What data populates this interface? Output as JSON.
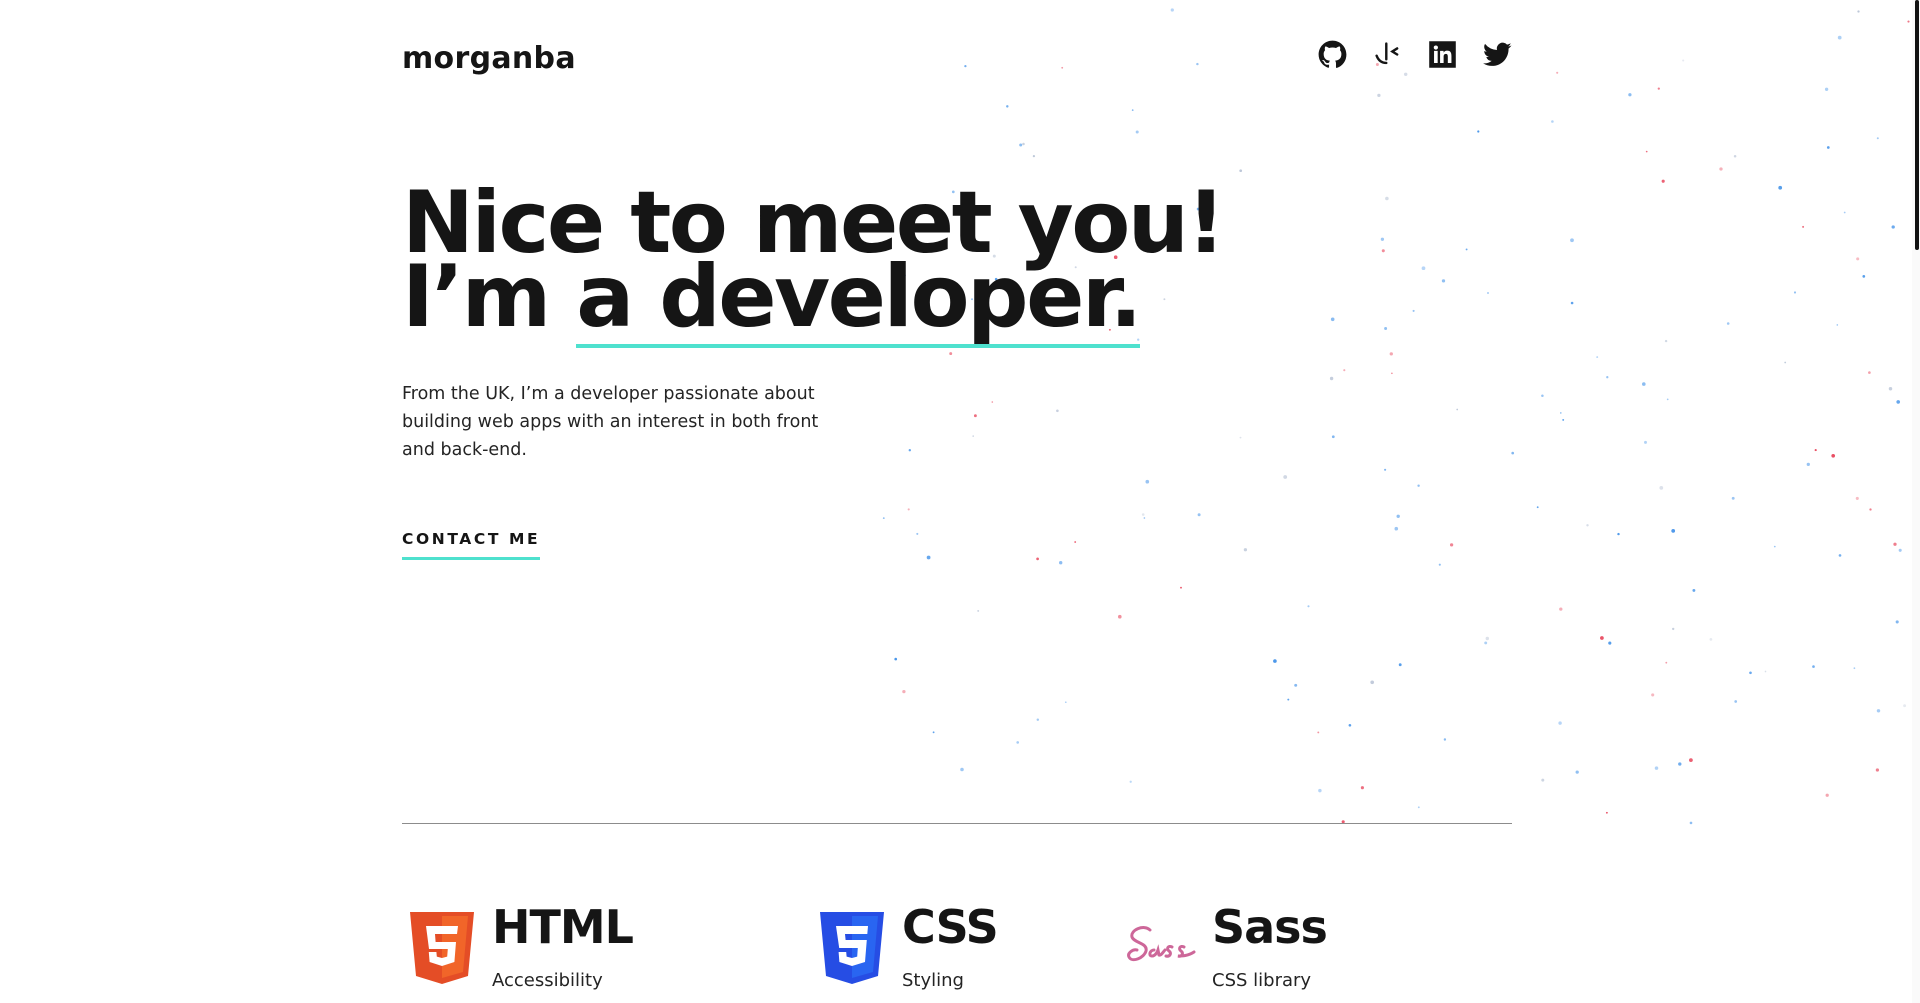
{
  "header": {
    "logo": "morganba",
    "social": [
      {
        "icon": "github-icon"
      },
      {
        "icon": "frontend-mentor-icon"
      },
      {
        "icon": "linkedin-icon"
      },
      {
        "icon": "twitter-icon"
      }
    ]
  },
  "hero": {
    "title_line1": "Nice to meet you!",
    "title_line2_prefix": "I’m ",
    "title_line2_highlight": "a developer.",
    "description": "From the UK, I’m a developer passionate about building web apps with an interest in both front and back-end.",
    "contact_label": "CONTACT ME"
  },
  "skills": [
    {
      "title": "HTML",
      "subtitle": "Accessibility",
      "icon": "html5-icon"
    },
    {
      "title": "CSS",
      "subtitle": "Styling",
      "icon": "css3-icon"
    },
    {
      "title": "Sass",
      "subtitle": "CSS library",
      "icon": "sass-icon"
    }
  ],
  "colors": {
    "accent": "#4ee1ce",
    "text": "#151515",
    "html_orange": "#e44d26",
    "css_blue": "#264de4",
    "sass_pink": "#cd6799",
    "particle_blue": "#3b8ee8",
    "particle_red": "#e8445a"
  }
}
